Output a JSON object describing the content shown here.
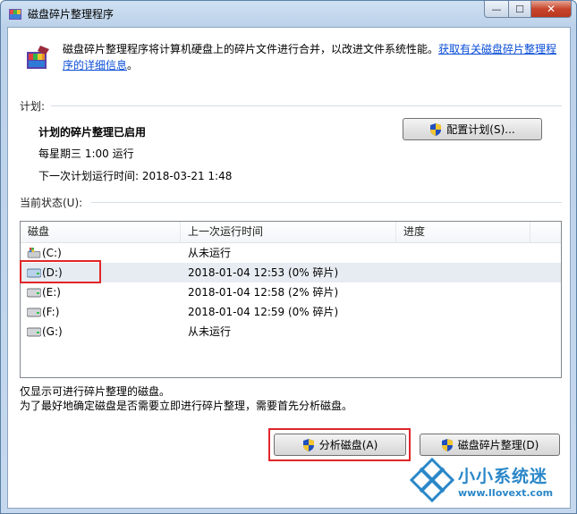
{
  "window": {
    "title": "磁盘碎片整理程序",
    "close_glyph": "✕",
    "max_glyph": "☐",
    "min_glyph": "—"
  },
  "intro": {
    "text": "磁盘碎片整理程序将计算机硬盘上的碎片文件进行合并，以改进文件系统性能。",
    "link_part1": "获取有关磁盘碎片整理程",
    "link_part2": "序的详细信息",
    "tail": "。"
  },
  "schedule": {
    "label": "计划:",
    "status": "计划的碎片整理已启用",
    "frequency": "每星期三  1:00 运行",
    "next_run": "下一次计划运行时间: 2018-03-21 1:48",
    "configure_button": "配置计划(S)..."
  },
  "current_status": {
    "label": "当前状态(U):",
    "columns": [
      "磁盘",
      "上一次运行时间",
      "进度"
    ],
    "rows": [
      {
        "disk": "(C:)",
        "last_run": "从未运行",
        "progress": "",
        "icon": "system-drive-icon"
      },
      {
        "disk": "(D:)",
        "last_run": "2018-01-04 12:53 (0% 碎片)",
        "progress": "",
        "icon": "drive-icon"
      },
      {
        "disk": "(E:)",
        "last_run": "2018-01-04 12:58 (2% 碎片)",
        "progress": "",
        "icon": "drive-icon"
      },
      {
        "disk": "(F:)",
        "last_run": "2018-01-04 12:59 (0% 碎片)",
        "progress": "",
        "icon": "drive-icon"
      },
      {
        "disk": "(G:)",
        "last_run": "从未运行",
        "progress": "",
        "icon": "drive-icon"
      }
    ]
  },
  "notes": {
    "line1": "仅显示可进行碎片整理的磁盘。",
    "line2": "为了最好地确定磁盘是否需要立即进行碎片整理，需要首先分析磁盘。"
  },
  "actions": {
    "analyze": "分析磁盘(A)",
    "defrag": "磁盘碎片整理(D)"
  },
  "watermark": {
    "brand": "小小系统迷",
    "url": "www.lIovext.com"
  },
  "colors": {
    "highlight": "#e0262a",
    "link": "#0b4ed6",
    "watermark": "#2a87c8"
  }
}
